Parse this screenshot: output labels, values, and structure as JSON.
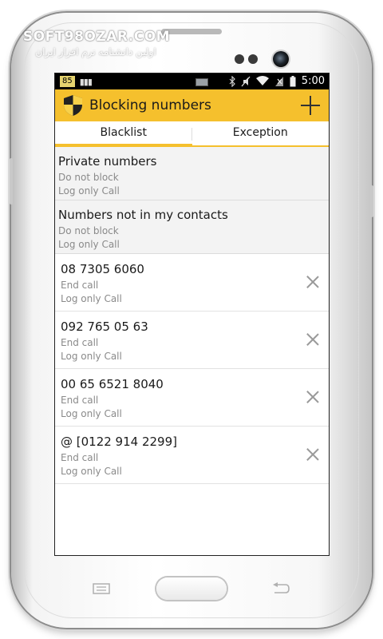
{
  "watermark": {
    "brand": "SOFT98OZAR.COM",
    "subtitle": "اولین دانشنامه نرم افزار ایران"
  },
  "status_bar": {
    "battery_badge": "85",
    "time": "5:00",
    "icons": [
      "bars-icon",
      "battery-small-icon",
      "bluetooth-icon",
      "mute-icon",
      "wifi-icon",
      "no-sim-icon",
      "battery-icon"
    ]
  },
  "app_bar": {
    "title": "Blocking numbers",
    "icon": "shield-icon",
    "add_icon": "plus-icon",
    "color": "#f5c02d"
  },
  "tabs": [
    {
      "label": "Blacklist",
      "active": true
    },
    {
      "label": "Exception",
      "active": false
    }
  ],
  "rules": [
    {
      "title": "Private numbers",
      "action": "Do not block",
      "log": "Log only Call"
    },
    {
      "title": "Numbers not in my contacts",
      "action": "Do not block",
      "log": "Log only Call"
    }
  ],
  "numbers": [
    {
      "number": "08 7305 6060",
      "action": "End call",
      "log": "Log only Call"
    },
    {
      "number": "092 765 05 63",
      "action": "End call",
      "log": "Log only Call"
    },
    {
      "number": "00 65 6521 8040",
      "action": "End call",
      "log": "Log only Call"
    },
    {
      "number": "@ [0122 914 2299]",
      "action": "End call",
      "log": "Log only Call"
    }
  ]
}
